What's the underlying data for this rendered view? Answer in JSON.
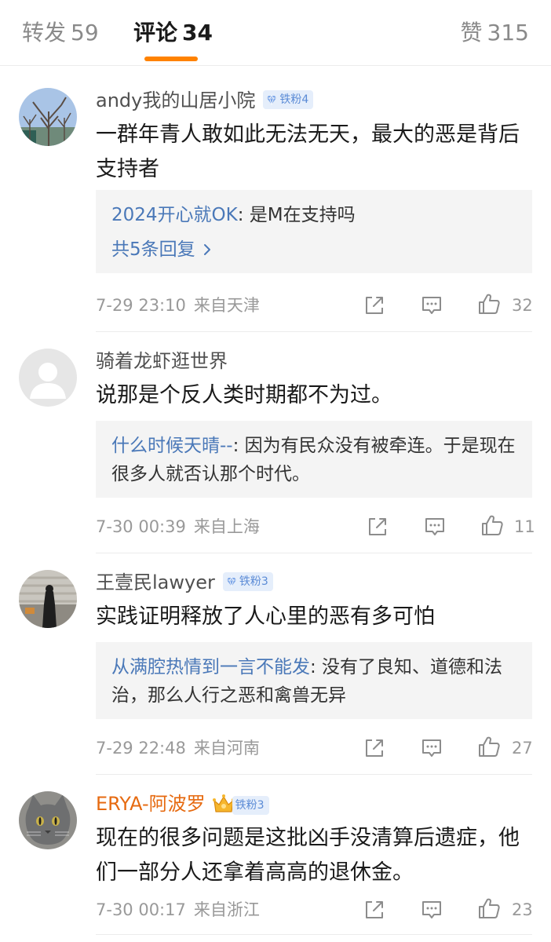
{
  "tabs": {
    "repost": {
      "label": "转发",
      "count": "59"
    },
    "comments": {
      "label": "评论",
      "count": "34"
    },
    "likes": {
      "label": "赞",
      "count": "315"
    }
  },
  "colors": {
    "accent": "#ff8200",
    "link": "#4a78b8",
    "badge_bg": "#e5eefb",
    "badge_text": "#5b8bd6",
    "gold_name": "#e66a10"
  },
  "comments": [
    {
      "user": "andy我的山居小院",
      "badge": "铁粉4",
      "avatar": "tree-sky-photo",
      "text": "一群年青人敢如此无法无天，最大的恶是背后支持者",
      "reply": {
        "user": "2024开心就OK",
        "text": ": 是M在支持吗"
      },
      "reply_more": "共5条回复",
      "time": "7-29 23:10",
      "location": "来自天津",
      "likes": "32"
    },
    {
      "user": "骑着龙虾逛世界",
      "avatar": "default-avatar",
      "text": "说那是个反人类时期都不为过。",
      "reply": {
        "user": "什么时候天晴--",
        "text": ": 因为有民众没有被牵连。于是现在很多人就否认那个时代。"
      },
      "time": "7-30 00:39",
      "location": "来自上海",
      "likes": "11"
    },
    {
      "user": "王壹民lawyer",
      "badge": "铁粉3",
      "avatar": "shadow-steps-photo",
      "text": "实践证明释放了人心里的恶有多可怕",
      "reply": {
        "user": "从满腔热情到一言不能发",
        "text": ": 没有了良知、道德和法治，那么人行之恶和禽兽无异"
      },
      "time": "7-29 22:48",
      "location": "来自河南",
      "likes": "27"
    },
    {
      "user": "ERYA-阿波罗",
      "badge": "铁粉3",
      "avatar": "gray-cat-photo",
      "text": "现在的很多问题是这批凶手没清算后遗症，他们一部分人还拿着高高的退休金。",
      "time": "7-30 00:17",
      "location": "来自浙江",
      "likes": "23"
    }
  ]
}
